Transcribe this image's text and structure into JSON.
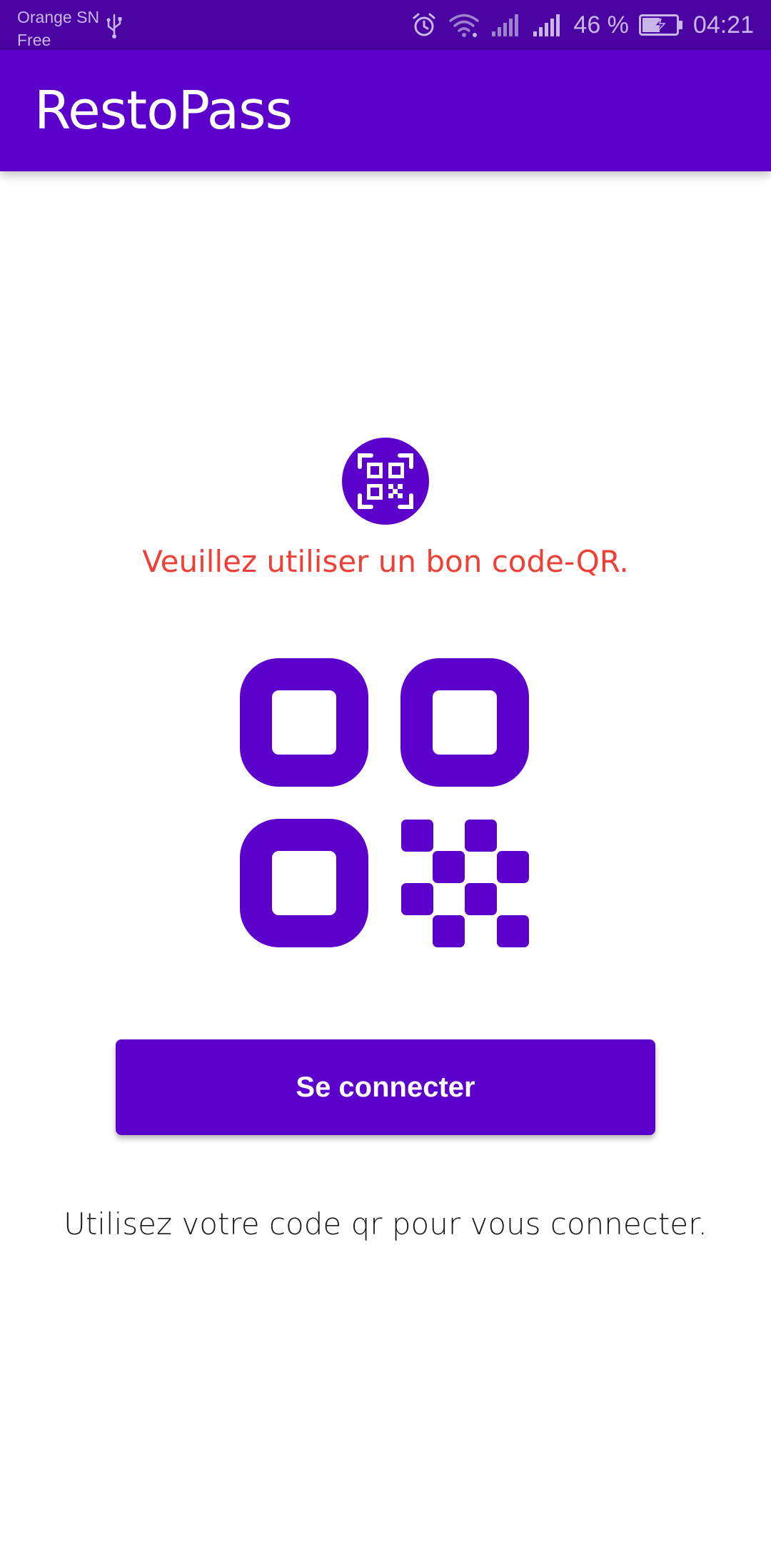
{
  "status_bar": {
    "carrier_line1": "Orange SN",
    "carrier_line2": "Free",
    "battery": "46 %",
    "time": "04:21",
    "icons": [
      "usb-icon",
      "alarm-icon",
      "wifi-icon",
      "signal-icon",
      "signal-icon",
      "battery-charging-icon"
    ]
  },
  "app_bar": {
    "title": "RestoPass"
  },
  "main": {
    "logo_icon": "qr-code-scan-icon",
    "error_message": "Veuillez utiliser un bon code-QR.",
    "qr_icon": "qr-code-icon",
    "login_button_label": "Se connecter",
    "hint": "Utilisez votre code qr pour vous connecter."
  },
  "colors": {
    "primary": "#5c00cc",
    "status_bar": "#4a03a0",
    "error": "#ee4036",
    "text": "#1b1b1b"
  }
}
